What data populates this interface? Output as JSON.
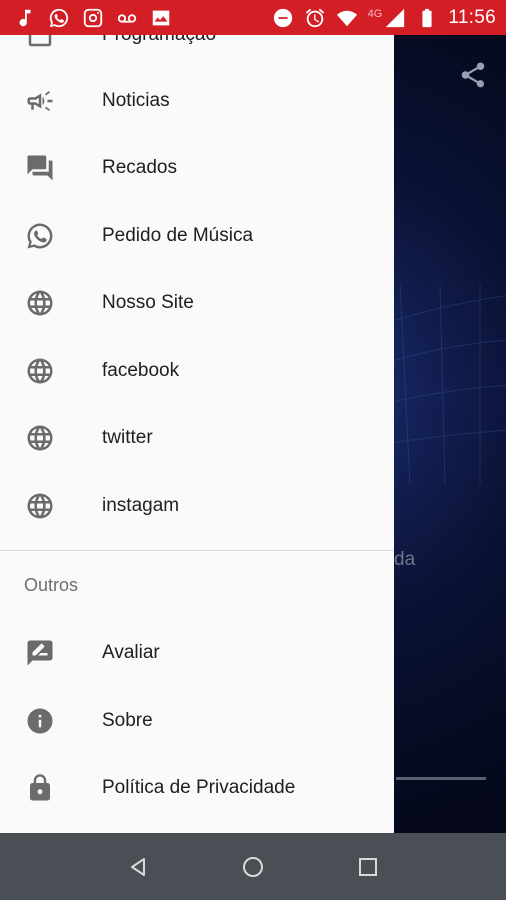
{
  "status_bar": {
    "network_label": "4G",
    "time": "11:56",
    "icons": [
      "music-note-icon",
      "whatsapp-icon",
      "instagram-icon",
      "voicemail-icon",
      "image-icon",
      "do-not-disturb-icon",
      "alarm-icon",
      "wifi-icon",
      "signal-icon",
      "battery-icon"
    ]
  },
  "background_app": {
    "status_text_fragment": "da",
    "share_icon": "share-icon"
  },
  "drawer": {
    "items": [
      {
        "label": "Programação",
        "icon": "schedule-icon"
      },
      {
        "label": "Noticias",
        "icon": "megaphone-icon"
      },
      {
        "label": "Recados",
        "icon": "messages-icon"
      },
      {
        "label": "Pedido de Música",
        "icon": "whatsapp-icon"
      },
      {
        "label": "Nosso Site",
        "icon": "globe-icon"
      },
      {
        "label": "facebook",
        "icon": "globe-icon"
      },
      {
        "label": "twitter",
        "icon": "globe-icon"
      },
      {
        "label": "instagam",
        "icon": "globe-icon"
      }
    ],
    "section_header": "Outros",
    "other_items": [
      {
        "label": "Avaliar",
        "icon": "rate-review-icon"
      },
      {
        "label": "Sobre",
        "icon": "info-icon"
      },
      {
        "label": "Política de Privacidade",
        "icon": "lock-icon"
      }
    ]
  },
  "nav_bar": {
    "buttons": [
      "back-icon",
      "home-icon",
      "recents-icon"
    ]
  },
  "colors": {
    "status_bar": "#d41e25",
    "drawer_bg": "#fafafa",
    "nav_bar": "#4a4f55",
    "icon_gray": "#6b6b6b"
  }
}
